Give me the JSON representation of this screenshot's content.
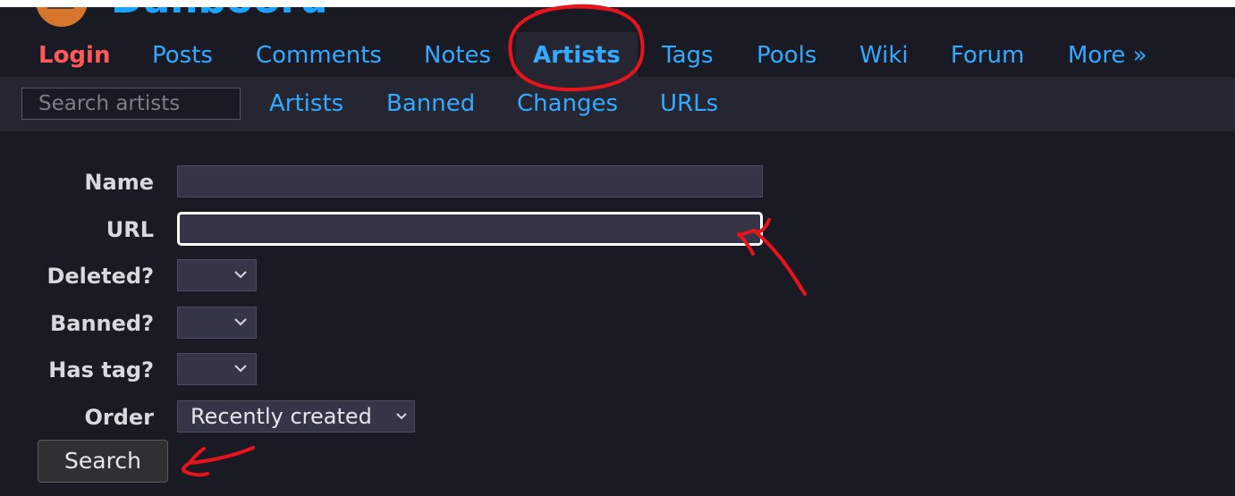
{
  "logo": {
    "text": "Danbooru"
  },
  "main_nav": [
    {
      "label": "Login",
      "state": "login"
    },
    {
      "label": "Posts",
      "state": "normal"
    },
    {
      "label": "Comments",
      "state": "normal"
    },
    {
      "label": "Notes",
      "state": "normal"
    },
    {
      "label": "Artists",
      "state": "active"
    },
    {
      "label": "Tags",
      "state": "normal"
    },
    {
      "label": "Pools",
      "state": "normal"
    },
    {
      "label": "Wiki",
      "state": "normal"
    },
    {
      "label": "Forum",
      "state": "normal"
    },
    {
      "label": "More »",
      "state": "normal"
    }
  ],
  "sub_nav": {
    "search_placeholder": "Search artists",
    "items": [
      "Artists",
      "Banned",
      "Changes",
      "URLs"
    ]
  },
  "form": {
    "name_label": "Name",
    "name_value": "",
    "url_label": "URL",
    "url_value": "",
    "deleted_label": "Deleted?",
    "deleted_value": "",
    "banned_label": "Banned?",
    "banned_value": "",
    "has_tag_label": "Has tag?",
    "has_tag_value": "",
    "order_label": "Order",
    "order_value": "Recently created",
    "search_button": "Search"
  },
  "colors": {
    "background": "#1a1a24",
    "subnav_background": "#262633",
    "link": "#33aaff",
    "login": "#ff5a5a",
    "annotation": "#e8141c"
  }
}
